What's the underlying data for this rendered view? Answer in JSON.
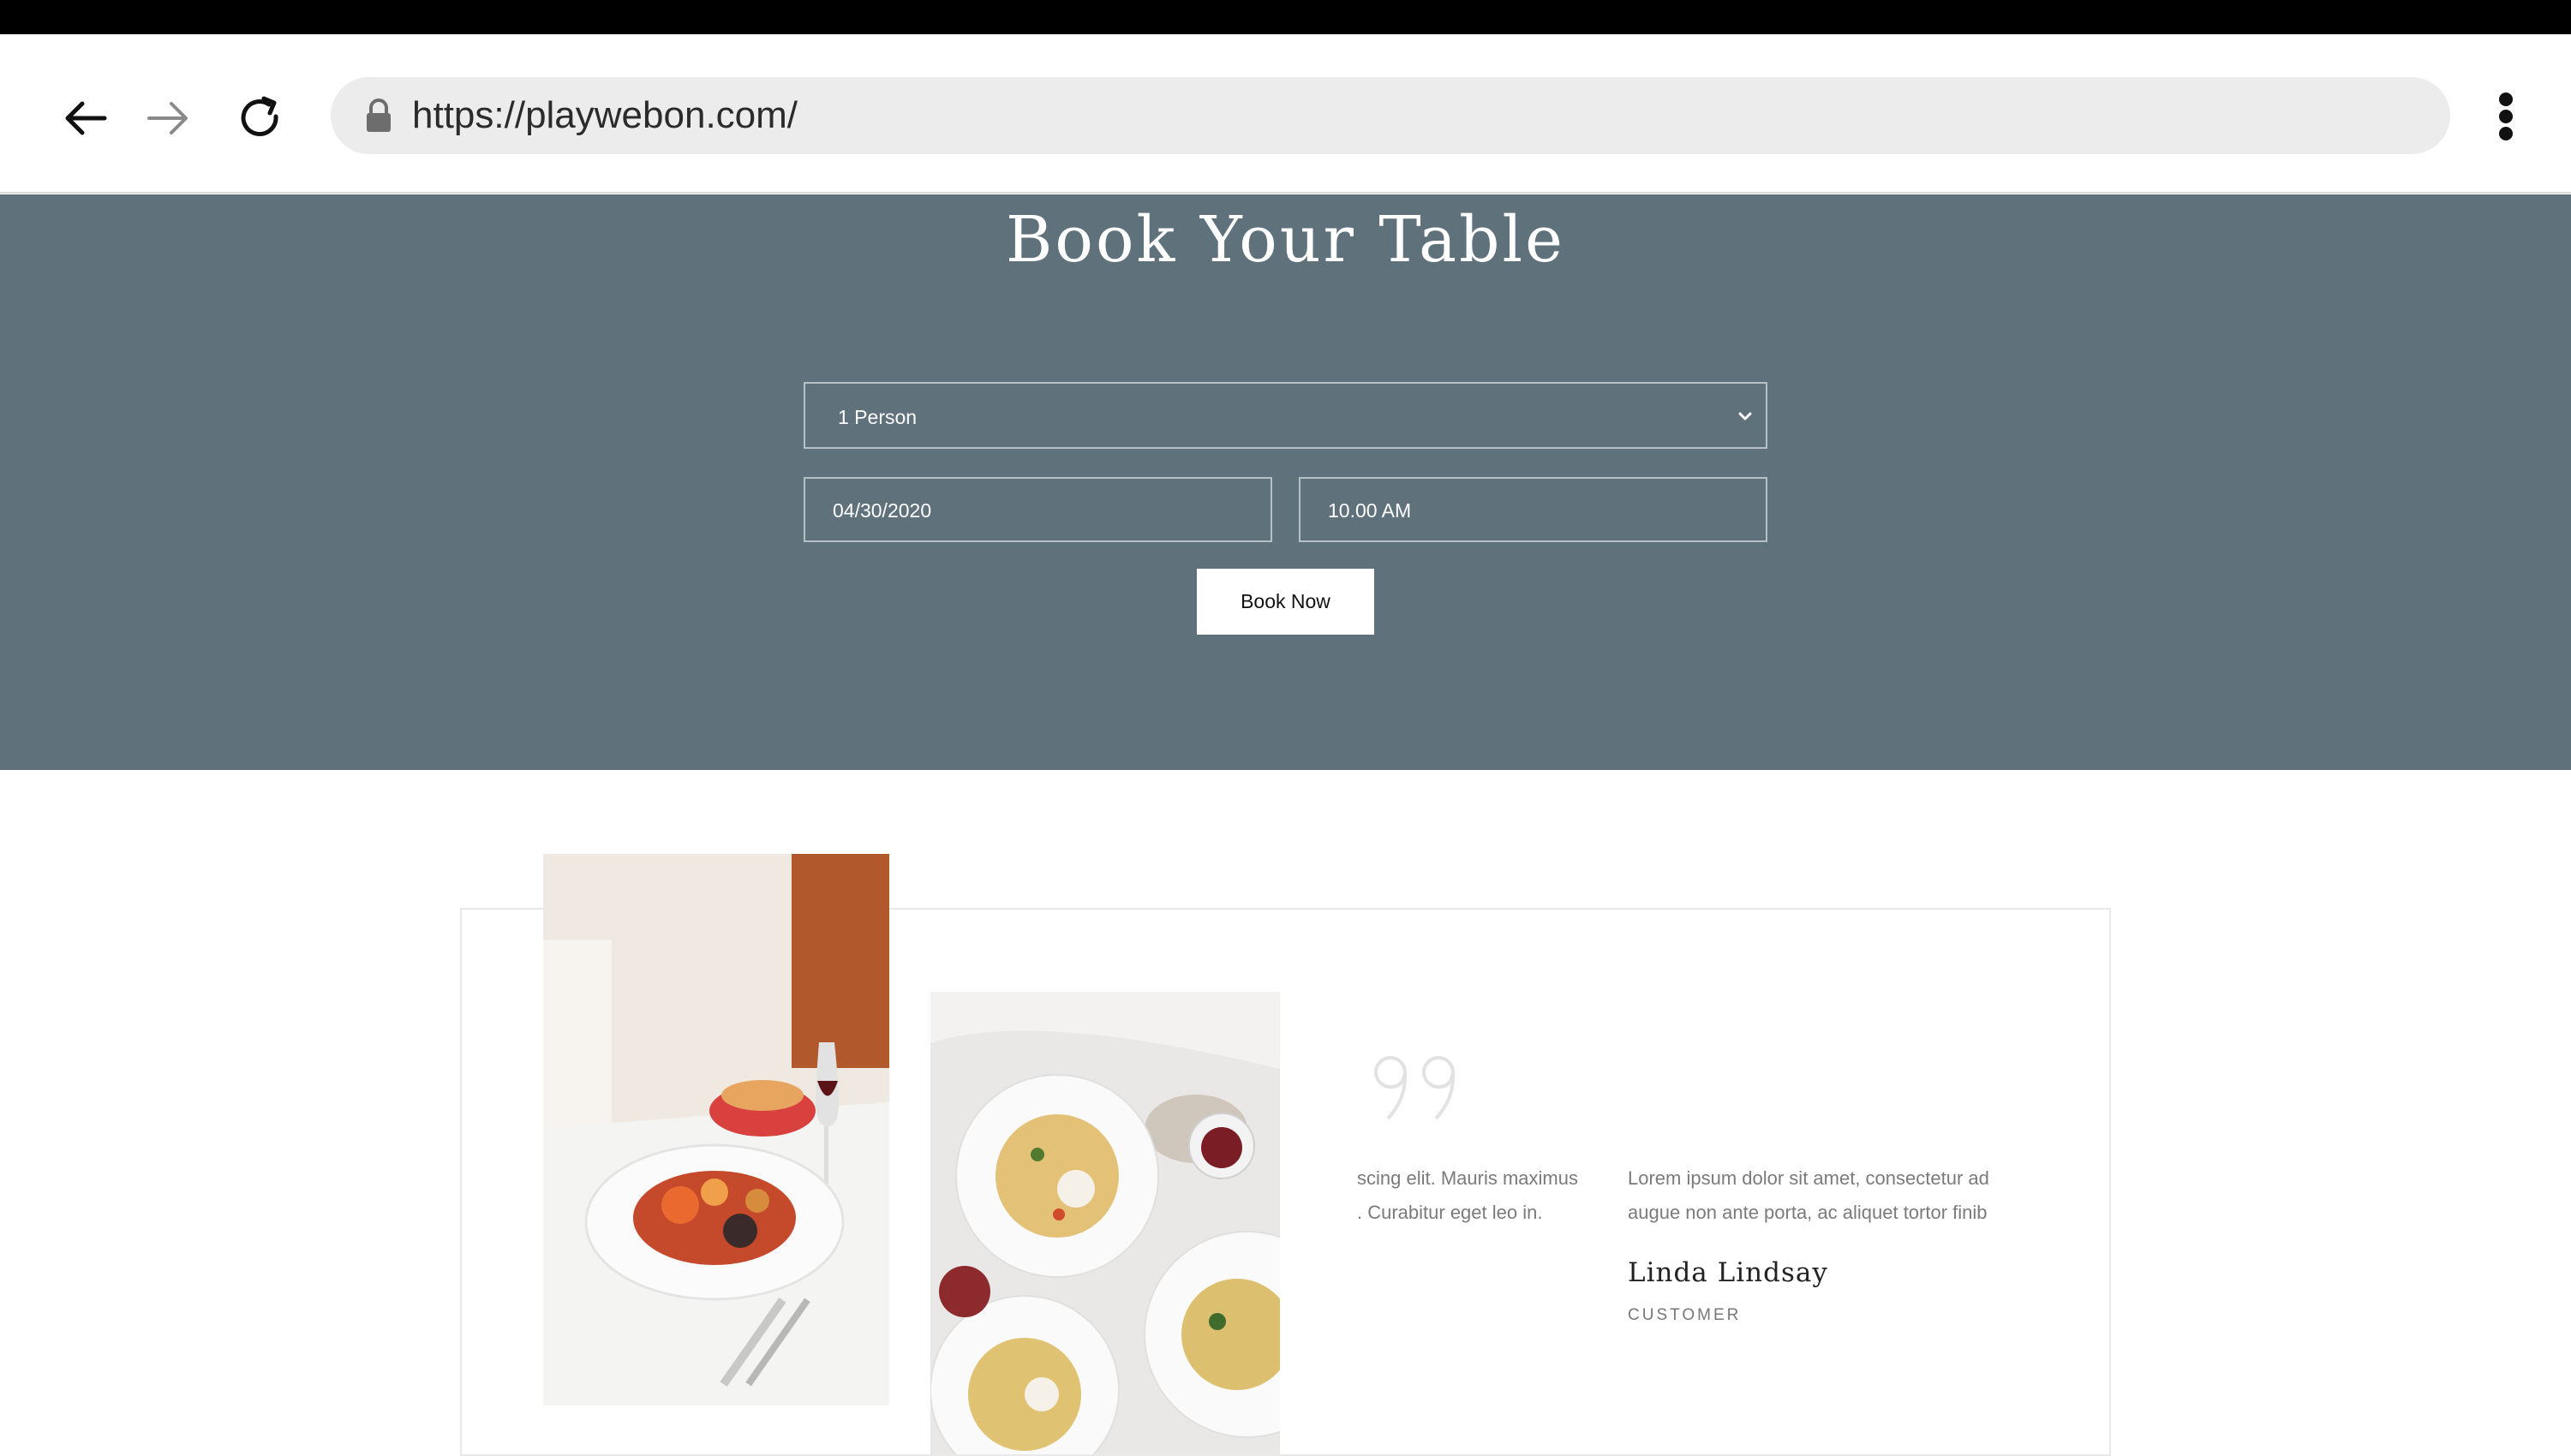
{
  "browser": {
    "url": "https://playwebon.com/",
    "back_icon": "arrow-left-icon",
    "forward_icon": "arrow-right-icon",
    "reload_icon": "reload-icon",
    "lock_icon": "lock-icon",
    "menu_icon": "more-vertical-icon"
  },
  "booking": {
    "title": "Book Your Table",
    "party_size": "1 Person",
    "date": "04/30/2020",
    "time": "10.00 AM",
    "button_label": "Book Now",
    "background_color": "#5f717b"
  },
  "testimonials": {
    "quote_icon": "quote-icon",
    "items": [
      {
        "text_line1": "scing elit. Mauris maximus",
        "text_line2": ". Curabitur eget leo in."
      },
      {
        "text_line1": "Lorem ipsum dolor sit amet, consectetur ad",
        "text_line2": "augue non ante porta, ac aliquet tortor finib",
        "author": "Linda Lindsay",
        "role": "CUSTOMER"
      }
    ]
  }
}
